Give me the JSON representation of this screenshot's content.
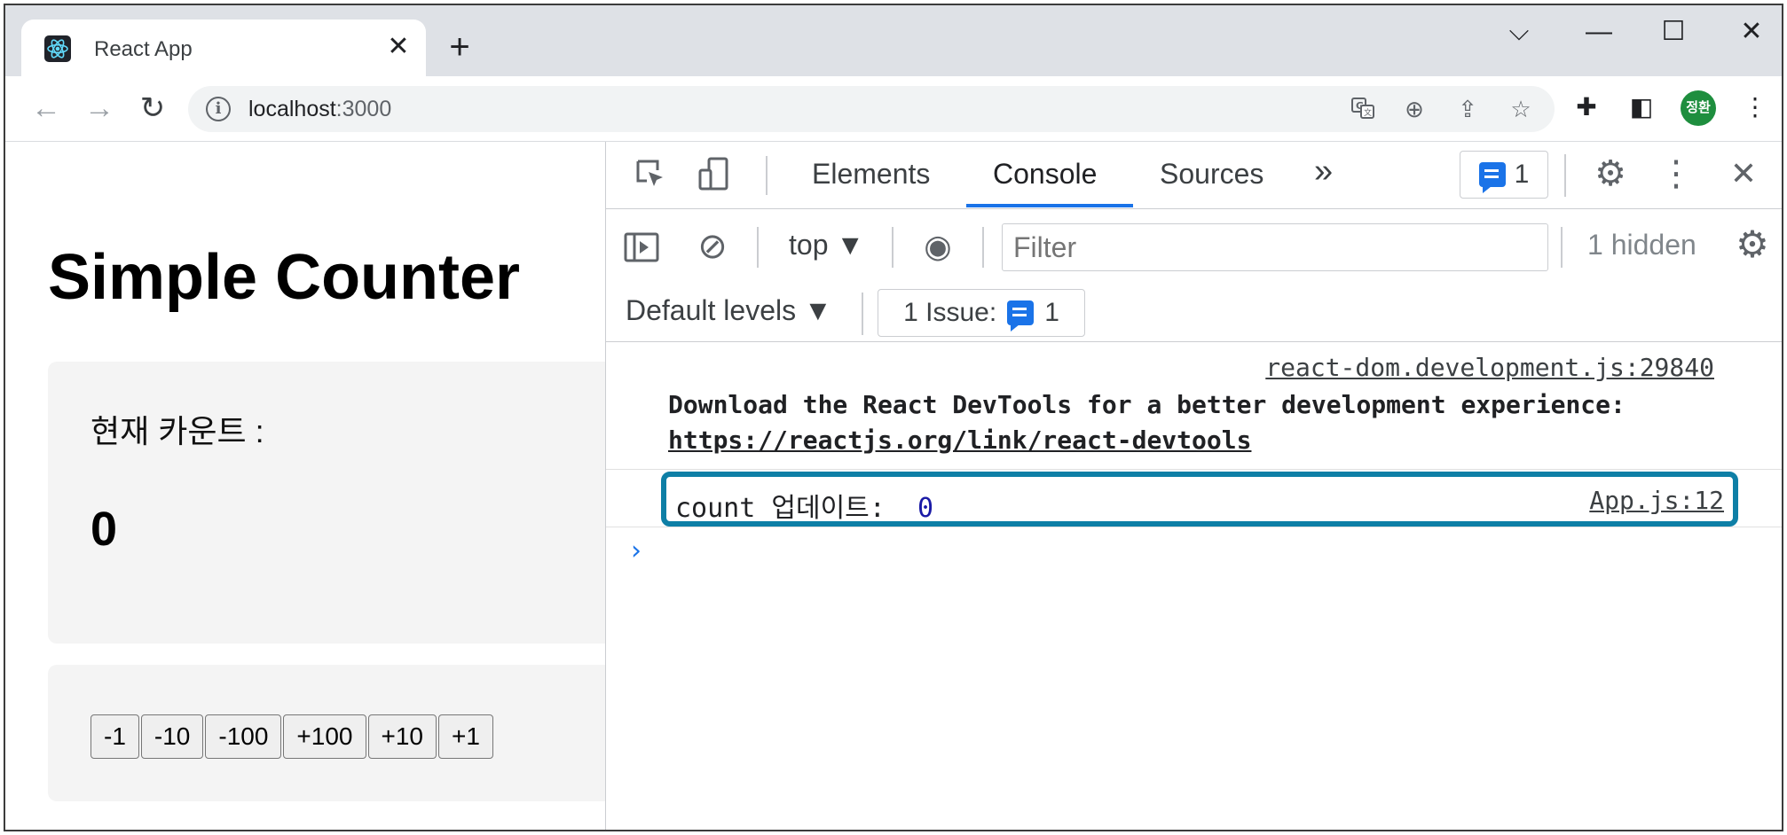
{
  "browser": {
    "tab": {
      "title": "React App",
      "close_glyph": "✕"
    },
    "new_tab_glyph": "+",
    "window_controls": {
      "chevron": "⌵",
      "minimize": "—",
      "maximize": "☐",
      "close": "✕"
    },
    "nav": {
      "back": "←",
      "forward": "→",
      "reload": "↻"
    },
    "address": {
      "host": "localhost",
      "port": ":3000",
      "info_glyph": "i"
    },
    "omnibox_icons": {
      "zoom": "⊕",
      "share": "⇪",
      "star": "☆"
    },
    "toolbar_icons": {
      "extensions": "✚",
      "sidepanel": "◧",
      "menu": "⋮"
    },
    "profile_initials": "정환"
  },
  "page": {
    "title": "Simple Counter",
    "count_label": "현재 카운트 :",
    "count_value": "0",
    "buttons": [
      "-1",
      "-10",
      "-100",
      "+100",
      "+10",
      "+1"
    ]
  },
  "devtools": {
    "tabs": [
      "Elements",
      "Console",
      "Sources"
    ],
    "active_tab": "Console",
    "more_tabs_glyph": "»",
    "issue_badge_count": "1",
    "icons": {
      "inspect": "⬚",
      "device": "▯",
      "settings": "⚙",
      "menu": "⋮",
      "close": "✕",
      "sidebar": "⊳",
      "clear": "⊘",
      "eye": "◉"
    },
    "context": "top ▼",
    "filter_placeholder": "Filter",
    "hidden_count": "1 hidden",
    "default_levels": "Default levels ▼",
    "issues_label": "1 Issue:",
    "issues_count": "1",
    "console": {
      "messages": [
        {
          "source": "react-dom.development.js:29840",
          "text": "Download the React DevTools for a better development experience:",
          "link": "https://reactjs.org/link/react-devtools"
        },
        {
          "source": "App.js:12",
          "text": "count 업데이트:",
          "value": "0"
        }
      ],
      "prompt": "›"
    }
  },
  "colors": {
    "tabstrip": "#dee1e6",
    "active_tab_underline": "#1a73e8",
    "highlight_border": "#0e7fa6",
    "number_value": "#1a1aa6",
    "avatar": "#1e8e3e"
  }
}
